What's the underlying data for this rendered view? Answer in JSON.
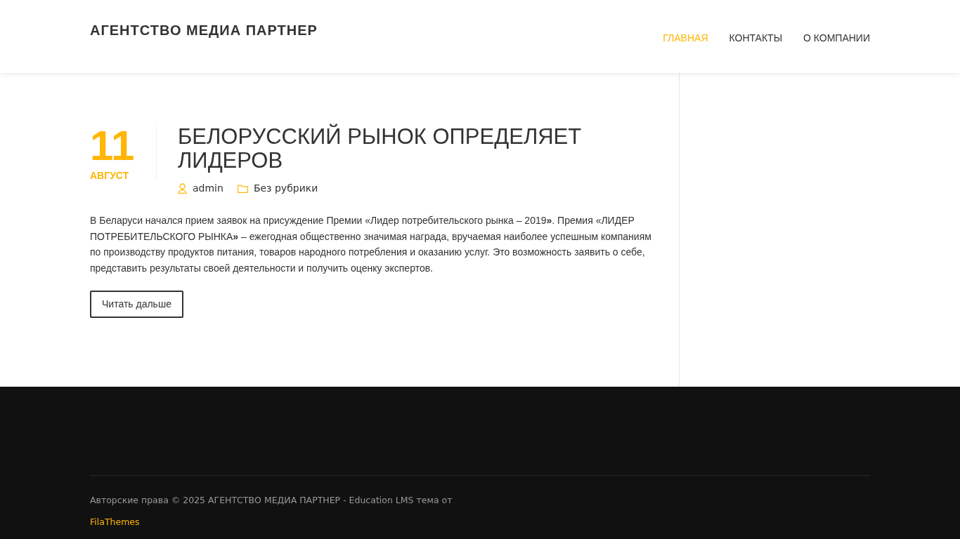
{
  "header": {
    "site_title": "АГЕНТСТВО МЕДИА ПАРТНЕР",
    "nav": [
      {
        "label": "ГЛАВНАЯ",
        "selected": true
      },
      {
        "label": "КОНТАКТЫ",
        "selected": false
      },
      {
        "label": "О КОМПАНИИ",
        "selected": false
      }
    ]
  },
  "post": {
    "day": "11",
    "month": "АВГУСТ",
    "title": "БЕЛОРУССКИЙ РЫНОК ОПРЕДЕЛЯЕТ ЛИДЕРОВ",
    "author": "admin",
    "category": "Без рубрики",
    "excerpt": "В Беларуси начался прием заявок на присуждение Премии «Лидер потребительского рынка – 2019**»**. Премия «ЛИДЕР ПОТРЕБИТЕЛЬСКОГО РЫНКА**»** – ежегодная общественно значимая награда, вручаемая наиболее успешным компаниям по производству продуктов питания, товаров народного потребления и оказанию услуг. Это возможность заявить о себе, представить результаты своей деятельности и получить оценку экспертов.",
    "read_more": "Читать дальше"
  },
  "footer": {
    "copyright": "Авторские права © 2025 АГЕНТСТВО МЕДИА ПАРТНЕР - Education LMS тема от",
    "link": "FilaThemes"
  }
}
